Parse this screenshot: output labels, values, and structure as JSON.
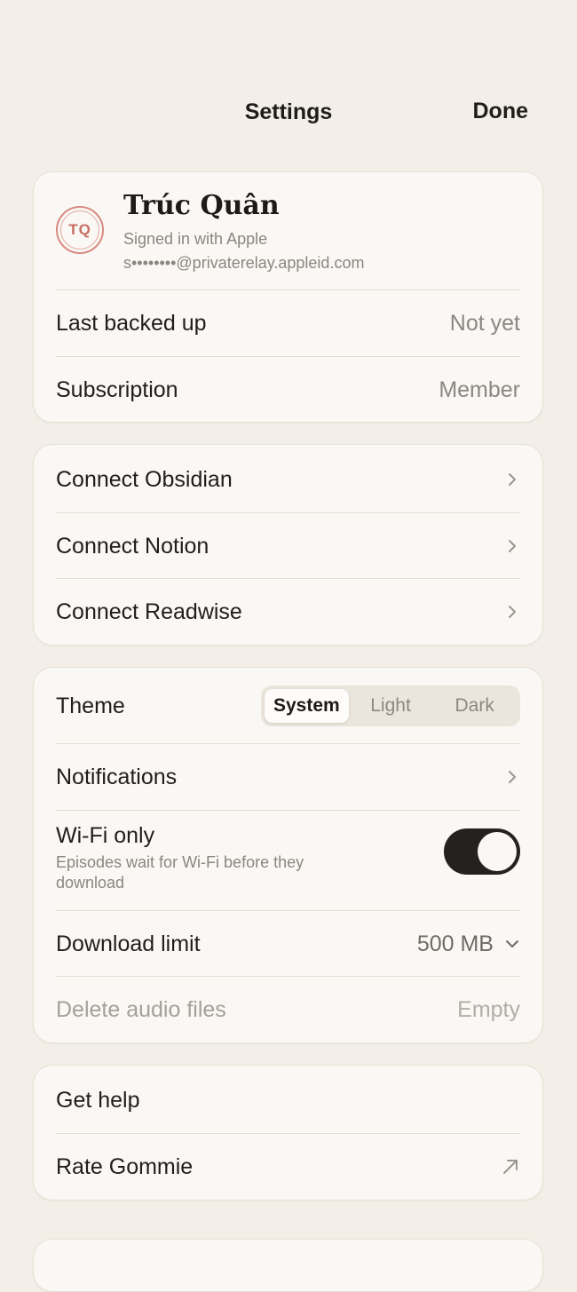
{
  "header": {
    "title": "Settings",
    "done_label": "Done"
  },
  "profile": {
    "initials": "TQ",
    "name": "Trúc Quân",
    "signin_method": "Signed in with Apple",
    "email": "s••••••••@privaterelay.appleid.com",
    "last_backed_up_label": "Last backed up",
    "last_backed_up_value": "Not yet",
    "subscription_label": "Subscription",
    "subscription_value": "Member"
  },
  "integrations": {
    "items": [
      {
        "label": "Connect Obsidian"
      },
      {
        "label": "Connect Notion"
      },
      {
        "label": "Connect Readwise"
      }
    ]
  },
  "preferences": {
    "theme_label": "Theme",
    "theme_options": [
      "System",
      "Light",
      "Dark"
    ],
    "theme_selected": "System",
    "notifications_label": "Notifications",
    "wifi_label": "Wi-Fi only",
    "wifi_description": "Episodes wait for Wi-Fi before they download",
    "wifi_enabled": true,
    "download_limit_label": "Download limit",
    "download_limit_value": "500 MB",
    "delete_audio_label": "Delete audio files",
    "delete_audio_value": "Empty"
  },
  "support": {
    "get_help_label": "Get help",
    "rate_label": "Rate Gommie"
  },
  "colors": {
    "background": "#f3efe8",
    "card": "#faf8f4",
    "accent_avatar": "#c96d62",
    "toggle_on": "#23221f"
  }
}
